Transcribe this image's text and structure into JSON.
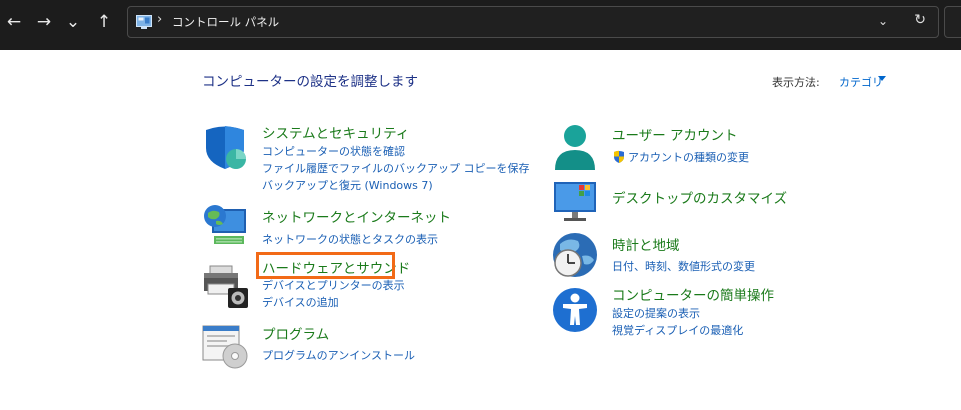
{
  "nav": {
    "back": "←",
    "forward": "→",
    "history": "⌄",
    "up": "↑",
    "breadcrumb_sep": "›",
    "address": "コントロール パネル",
    "dropdown": "⌄",
    "refresh": "↻"
  },
  "header": {
    "title": "コンピューターの設定を調整します",
    "view_label": "表示方法:",
    "view_value": "カテゴリ"
  },
  "categories": {
    "system": {
      "title": "システムとセキュリティ",
      "links": [
        "コンピューターの状態を確認",
        "ファイル履歴でファイルのバックアップ コピーを保存",
        "バックアップと復元 (Windows 7)"
      ]
    },
    "network": {
      "title": "ネットワークとインターネット",
      "links": [
        "ネットワークの状態とタスクの表示"
      ]
    },
    "hardware": {
      "title": "ハードウェアとサウンド",
      "links": [
        "デバイスとプリンターの表示",
        "デバイスの追加"
      ]
    },
    "programs": {
      "title": "プログラム",
      "links": [
        "プログラムのアンインストール"
      ]
    },
    "user": {
      "title": "ユーザー アカウント",
      "links": [
        "アカウントの種類の変更"
      ]
    },
    "desktop": {
      "title": "デスクトップのカスタマイズ",
      "links": []
    },
    "clock": {
      "title": "時計と地域",
      "links": [
        "日付、時刻、数値形式の変更"
      ]
    },
    "access": {
      "title": "コンピューターの簡単操作",
      "links": [
        "設定の提案の表示",
        "視覚ディスプレイの最適化"
      ]
    }
  },
  "colors": {
    "title_green": "#1a7a1a",
    "link_blue": "#1a5fb4",
    "highlight_orange": "#f26a17",
    "topbar": "#1c1c1c"
  }
}
